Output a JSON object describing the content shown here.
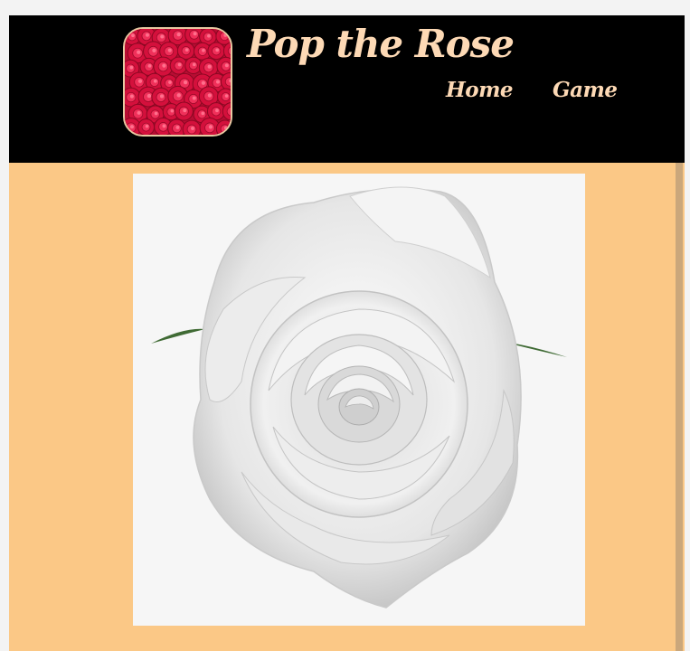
{
  "header": {
    "site_title": "Pop the Rose",
    "logo_name": "rose-bouquet-logo"
  },
  "nav": {
    "items": [
      {
        "label": "Home"
      },
      {
        "label": "Game"
      }
    ]
  },
  "main": {
    "rose_image_name": "white-rose-image"
  },
  "colors": {
    "header_bg": "#000000",
    "title_text": "#fdd9b5",
    "nav_text": "#fdd9b5",
    "content_bg": "#fbc886",
    "logo_border": "#e8c9a2",
    "logo_rose": "#d4103c",
    "rose_frame_bg": "#f6f6f6"
  }
}
